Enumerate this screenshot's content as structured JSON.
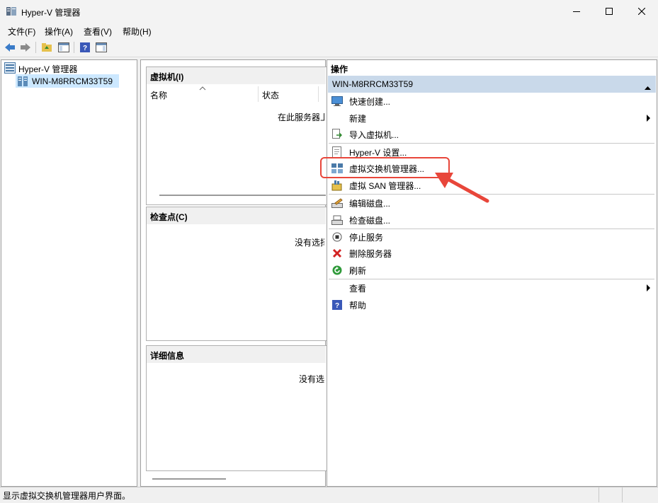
{
  "window": {
    "title": "Hyper-V 管理器"
  },
  "menu": [
    "文件(F)",
    "操作(A)",
    "查看(V)",
    "帮助(H)"
  ],
  "tree": {
    "root": "Hyper-V 管理器",
    "server": "WIN-M8RRCM33T59"
  },
  "vm_panel": {
    "title": "虚拟机(I)",
    "col_name": "名称",
    "col_state": "状态",
    "empty_text": "在此服务器上"
  },
  "checkpoint_panel": {
    "title": "检查点(C)",
    "empty_text": "没有选择"
  },
  "details_panel": {
    "title": "详细信息",
    "empty_text": "没有选"
  },
  "actions": {
    "title": "操作",
    "group": "WIN-M8RRCM33T59",
    "items": [
      {
        "label": "快速创建...",
        "icon": "quick-create-icon"
      },
      {
        "label": "新建",
        "icon": "",
        "submenu": true
      },
      {
        "label": "导入虚拟机...",
        "icon": "import-icon"
      },
      {
        "label": "Hyper-V 设置...",
        "icon": "settings-icon"
      },
      {
        "label": "虚拟交换机管理器...",
        "icon": "switch-icon"
      },
      {
        "label": "虚拟 SAN 管理器...",
        "icon": "san-icon"
      },
      {
        "label": "编辑磁盘...",
        "icon": "edit-disk-icon"
      },
      {
        "label": "检查磁盘...",
        "icon": "inspect-disk-icon"
      },
      {
        "label": "停止服务",
        "icon": "stop-icon"
      },
      {
        "label": "删除服务器",
        "icon": "delete-icon"
      },
      {
        "label": "刷新",
        "icon": "refresh-icon"
      },
      {
        "label": "查看",
        "icon": "",
        "submenu": true
      },
      {
        "label": "帮助",
        "icon": "help-icon"
      }
    ]
  },
  "status": "显示虚拟交换机管理器用户界面。",
  "colors": {
    "highlight": "#e8463a",
    "group_header": "#c9d9ea",
    "selected": "#cce8ff"
  }
}
